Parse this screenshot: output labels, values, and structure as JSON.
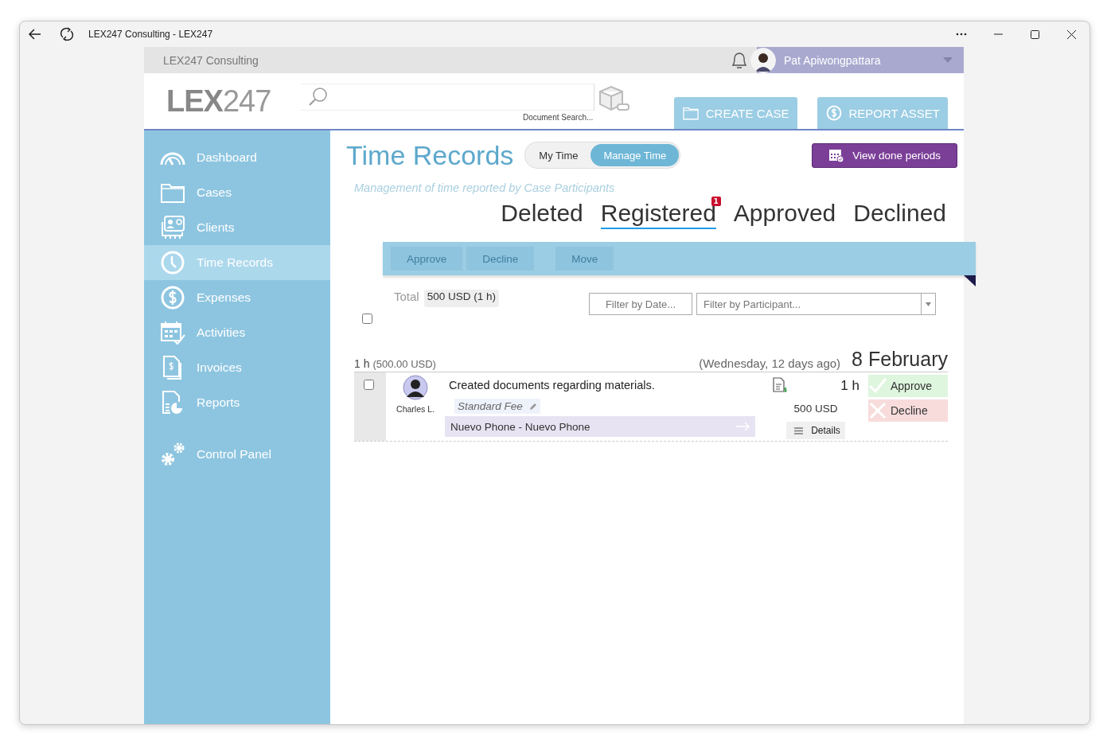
{
  "window": {
    "title": "LEX247 Consulting - LEX247"
  },
  "topbar": {
    "company": "LEX247 Consulting",
    "user": "Pat Apiwongpattara"
  },
  "header": {
    "logo_bold": "LEX",
    "logo_light": "247",
    "search_caption": "Document Search...",
    "buttons": [
      {
        "label": "CREATE CASE"
      },
      {
        "label": "REPORT ASSET"
      }
    ]
  },
  "sidebar": {
    "items": [
      {
        "label": "Dashboard",
        "selected": false
      },
      {
        "label": "Cases",
        "selected": false
      },
      {
        "label": "Clients",
        "selected": false
      },
      {
        "label": "Time Records",
        "selected": true
      },
      {
        "label": "Expenses",
        "selected": false
      },
      {
        "label": "Activities",
        "selected": false
      },
      {
        "label": "Invoices",
        "selected": false
      },
      {
        "label": "Reports",
        "selected": false
      }
    ],
    "bottom_items": [
      {
        "label": "Control Panel",
        "selected": false
      }
    ]
  },
  "page": {
    "title": "Time Records",
    "toggle": [
      {
        "label": "My Time",
        "selected": false
      },
      {
        "label": "Manage Time",
        "selected": true
      }
    ],
    "action": "View done periods",
    "subtitle": "Management of time reported by Case Participants",
    "tabs": [
      {
        "label": "Deleted",
        "selected": false
      },
      {
        "label": "Registered",
        "selected": true,
        "badge": "1"
      },
      {
        "label": "Approved",
        "selected": false
      },
      {
        "label": "Declined",
        "selected": false
      }
    ],
    "bulk_actions": [
      {
        "label": "Approve",
        "disabled": true
      },
      {
        "label": "Decline",
        "disabled": true
      },
      {
        "label": "Move",
        "disabled": true
      }
    ],
    "select_all": {
      "checked": false
    },
    "total_label": "Total",
    "total_value": "500 USD (1 h)",
    "filters": {
      "date_placeholder": "Filter by Date...",
      "participant_placeholder": "Filter by Participant..."
    },
    "groups": [
      {
        "hours": "1 h",
        "amount": "(500.00 USD)",
        "weekday": "(Wednesday, 12 days ago)",
        "date": "8 February",
        "entries": [
          {
            "checked": false,
            "person": "Charles L.",
            "description": "Created documents regarding materials.",
            "fee": "Standard Fee",
            "matter": "Nuevo Phone - Nuevo Phone",
            "hours": "1 h",
            "amount": "500 USD",
            "details": "Details",
            "approve": "Approve",
            "decline": "Decline"
          }
        ]
      }
    ]
  }
}
